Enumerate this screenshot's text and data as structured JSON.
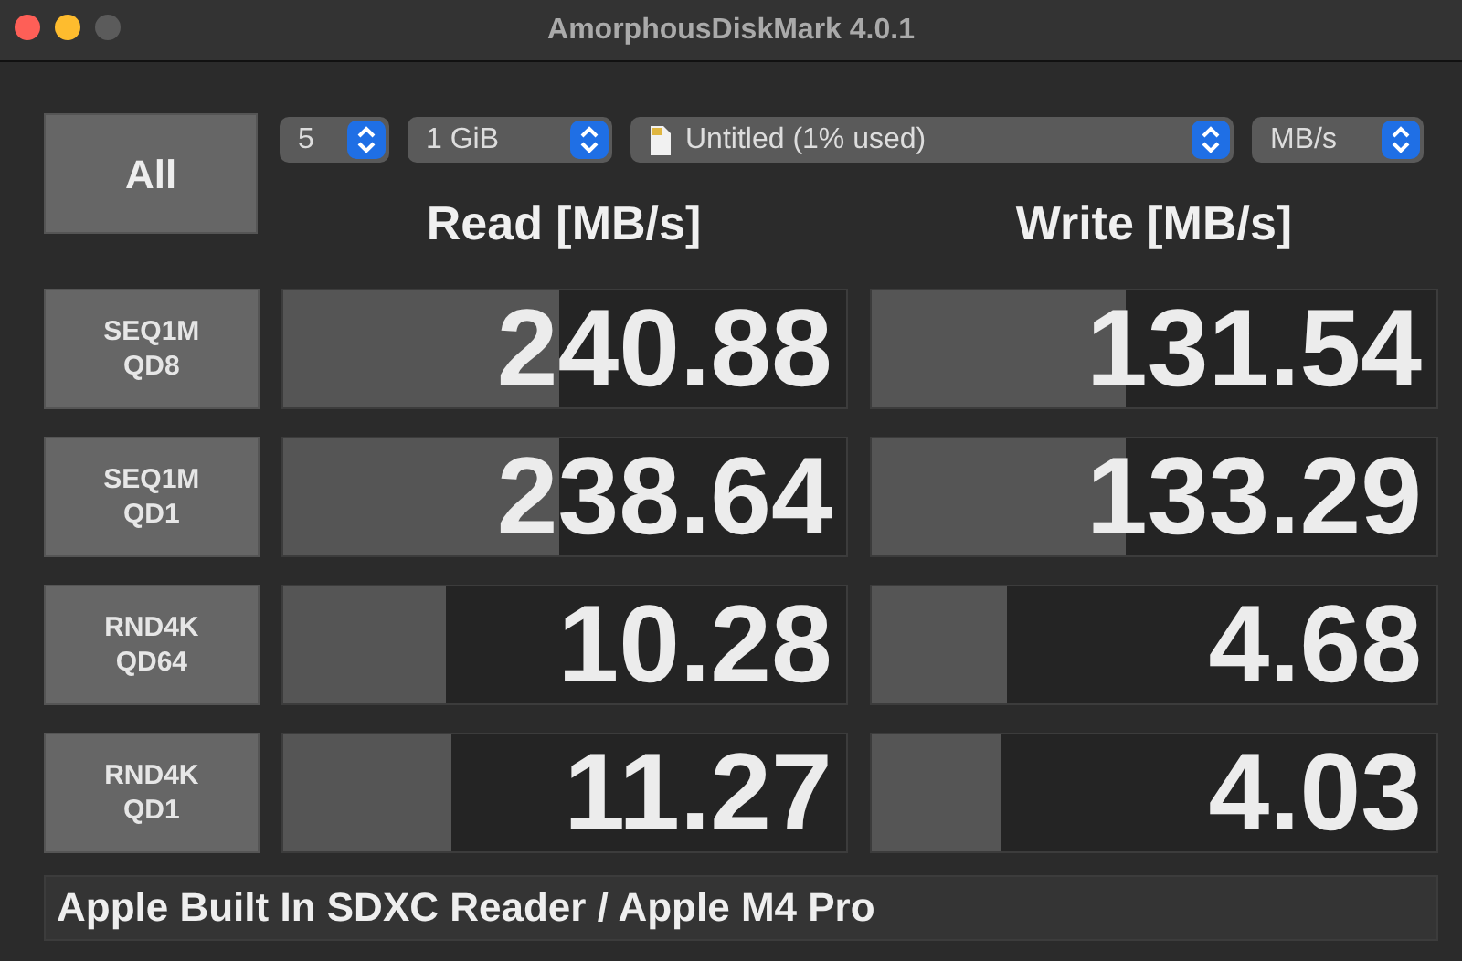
{
  "window": {
    "title": "AmorphousDiskMark 4.0.1",
    "controls": [
      {
        "kind": "close",
        "disabled": false
      },
      {
        "kind": "minimize",
        "disabled": false
      },
      {
        "kind": "zoom",
        "disabled": true
      }
    ]
  },
  "all_button": {
    "label": "All"
  },
  "selectors": [
    {
      "kind": "count",
      "value": "5"
    },
    {
      "kind": "size",
      "value": "1 GiB"
    },
    {
      "kind": "disk",
      "value": "Untitled (1% used)"
    },
    {
      "kind": "unit",
      "value": "MB/s"
    }
  ],
  "headers": {
    "read": "Read [MB/s]",
    "write": "Write [MB/s]"
  },
  "tests": [
    {
      "label_line1": "SEQ1M",
      "label_line2": "QD8",
      "read": {
        "value": "240.88",
        "level": 0.49
      },
      "write": {
        "value": "131.54",
        "level": 0.45
      }
    },
    {
      "label_line1": "SEQ1M",
      "label_line2": "QD1",
      "read": {
        "value": "238.64",
        "level": 0.49
      },
      "write": {
        "value": "133.29",
        "level": 0.45
      }
    },
    {
      "label_line1": "RND4K",
      "label_line2": "QD64",
      "read": {
        "value": "10.28",
        "level": 0.29
      },
      "write": {
        "value": "4.68",
        "level": 0.24
      }
    },
    {
      "label_line1": "RND4K",
      "label_line2": "QD1",
      "read": {
        "value": "11.27",
        "level": 0.3
      },
      "write": {
        "value": "4.03",
        "level": 0.23
      }
    }
  ],
  "status_bar": {
    "text": "Apple Built In SDXC Reader / Apple M4 Pro"
  }
}
